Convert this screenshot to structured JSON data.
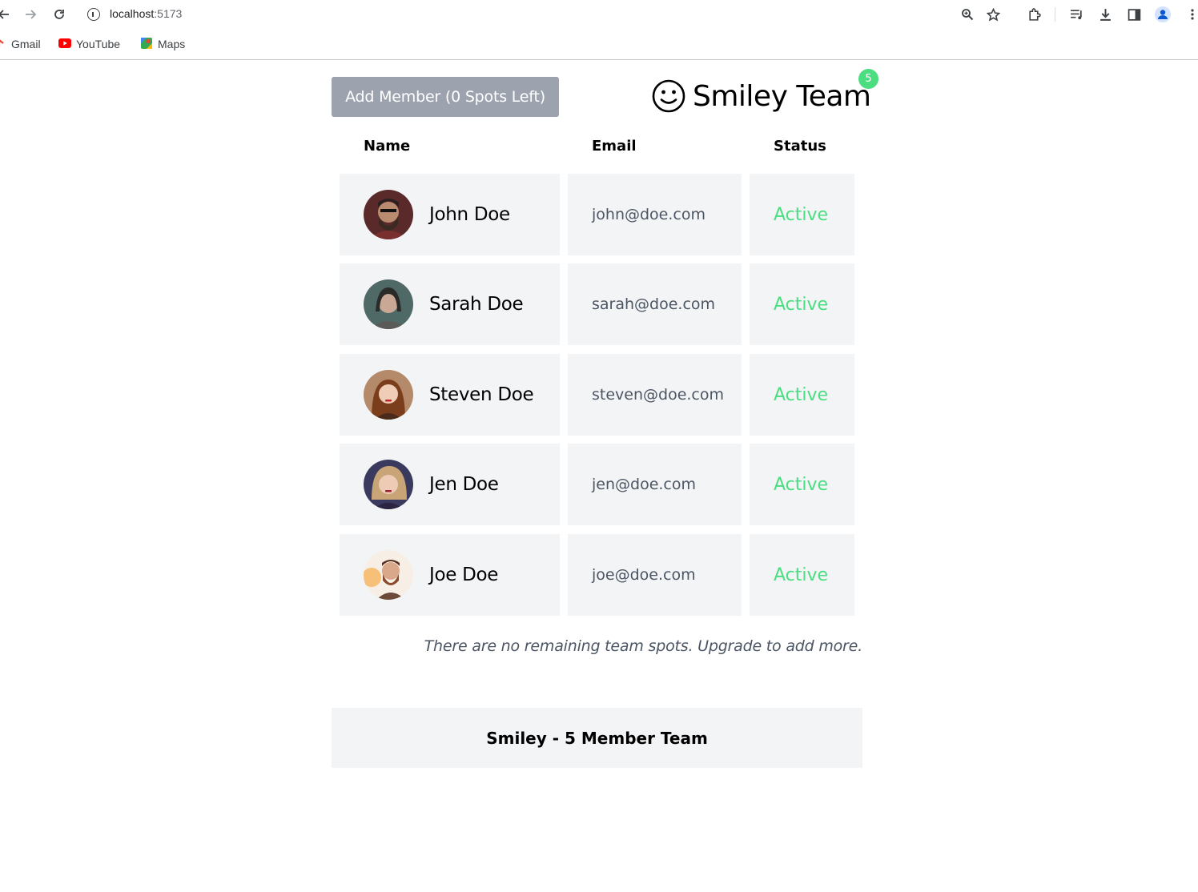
{
  "browser": {
    "url_host": "localhost",
    "url_port": ":5173",
    "bookmarks": [
      {
        "label": "Gmail",
        "icon": "gmail-icon"
      },
      {
        "label": "YouTube",
        "icon": "youtube-icon"
      },
      {
        "label": "Maps",
        "icon": "maps-icon"
      }
    ]
  },
  "header": {
    "add_button_label": "Add Member (0 Spots Left)",
    "brand_icon": "smiley-icon",
    "title": "Smiley Team",
    "member_count": "5"
  },
  "table": {
    "columns": [
      "Name",
      "Email",
      "Status"
    ],
    "rows": [
      {
        "name": "John Doe",
        "email": "john@doe.com",
        "status": "Active"
      },
      {
        "name": "Sarah Doe",
        "email": "sarah@doe.com",
        "status": "Active"
      },
      {
        "name": "Steven Doe",
        "email": "steven@doe.com",
        "status": "Active"
      },
      {
        "name": "Jen Doe",
        "email": "jen@doe.com",
        "status": "Active"
      },
      {
        "name": "Joe Doe",
        "email": "joe@doe.com",
        "status": "Active"
      }
    ]
  },
  "notice": "There are no remaining team spots. Upgrade to add more.",
  "footer": "Smiley - 5 Member Team",
  "colors": {
    "accent_green": "#4ade80",
    "button_gray": "#9ca3af",
    "cell_bg": "#f3f4f6"
  }
}
